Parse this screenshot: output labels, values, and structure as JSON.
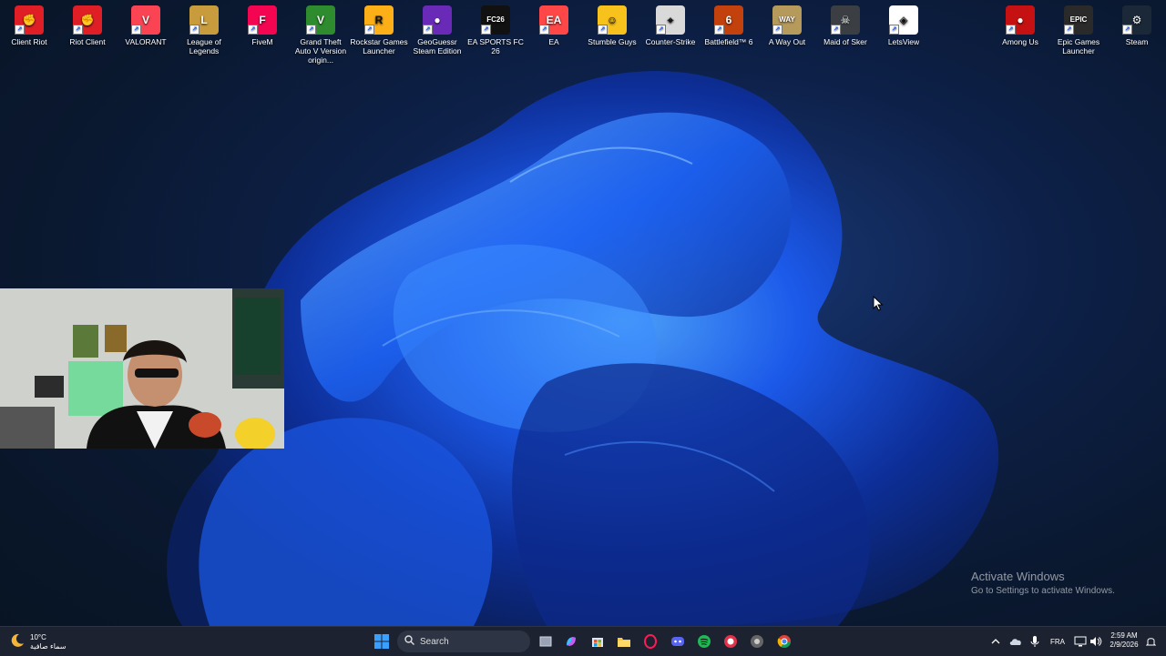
{
  "desktop_icons": [
    {
      "label": "Client Riot",
      "icon": "riot-client-icon",
      "color": "#e01e26"
    },
    {
      "label": "Riot Client",
      "icon": "riot-client-icon",
      "color": "#e01e26"
    },
    {
      "label": "VALORANT",
      "icon": "valorant-icon",
      "color": "#fa4454"
    },
    {
      "label": "League of Legends",
      "icon": "league-of-legends-icon",
      "color": "#c89b3c"
    },
    {
      "label": "FiveM",
      "icon": "fivem-icon",
      "color": "#f40552"
    },
    {
      "label": "Grand Theft Auto V Version origin...",
      "icon": "gta-v-icon",
      "color": "#2e8b2e"
    },
    {
      "label": "Rockstar Games Launcher",
      "icon": "rockstar-icon",
      "color": "#fcaf17"
    },
    {
      "label": "GeoGuessr Steam Edition",
      "icon": "geoguessr-icon",
      "color": "#6a2ab8"
    },
    {
      "label": "EA SPORTS FC 26",
      "icon": "ea-fc-icon",
      "color": "#111111"
    },
    {
      "label": "EA",
      "icon": "ea-icon",
      "color": "#ff4747"
    },
    {
      "label": "Stumble Guys",
      "icon": "stumble-guys-icon",
      "color": "#f8c21c"
    },
    {
      "label": "Counter-Strike",
      "icon": "counter-strike-icon",
      "color": "#d9d9d9"
    },
    {
      "label": "Battlefield™ 6",
      "icon": "battlefield-icon",
      "color": "#c2410c"
    },
    {
      "label": "A Way Out",
      "icon": "a-way-out-icon",
      "color": "#b69a5c"
    },
    {
      "label": "Maid of Sker",
      "icon": "maid-of-sker-icon",
      "color": "#3b3f44"
    },
    {
      "label": "LetsView",
      "icon": "letsview-icon",
      "color": "#ffffff"
    },
    {
      "label": "Among Us",
      "icon": "among-us-icon",
      "color": "#c51111"
    },
    {
      "label": "Epic Games Launcher",
      "icon": "epic-games-icon",
      "color": "#2a2a2a"
    },
    {
      "label": "Steam",
      "icon": "steam-icon",
      "color": "#1b2838"
    }
  ],
  "icon_glyphs": [
    "✊",
    "✊",
    "V",
    "L",
    "F",
    "V",
    "R",
    "●",
    "FC26",
    "EA",
    "☺",
    "⌖",
    "6",
    "WAY",
    "☠",
    "◈",
    "●",
    "EPIC",
    "⚙"
  ],
  "watermark": {
    "title": "Activate Windows",
    "subtitle": "Go to Settings to activate Windows."
  },
  "taskbar": {
    "weather": {
      "temp": "10°C",
      "condition": "سماء صافية",
      "icon": "moon-icon"
    },
    "search_placeholder": "Search",
    "pinned_apps": [
      "windows-start-icon",
      "task-view-icon",
      "copilot-icon",
      "microsoft-store-icon",
      "file-explorer-icon",
      "opera-gx-icon",
      "discord-icon",
      "spotify-icon",
      "obs-icon",
      "chrome-icon",
      "chrome-icon-2"
    ],
    "language": "FRA",
    "time": "2:59 AM",
    "date": "2/9/2026"
  },
  "colors": {
    "taskbar_bg": "#1c2230",
    "accent": "#1a6cf5"
  }
}
